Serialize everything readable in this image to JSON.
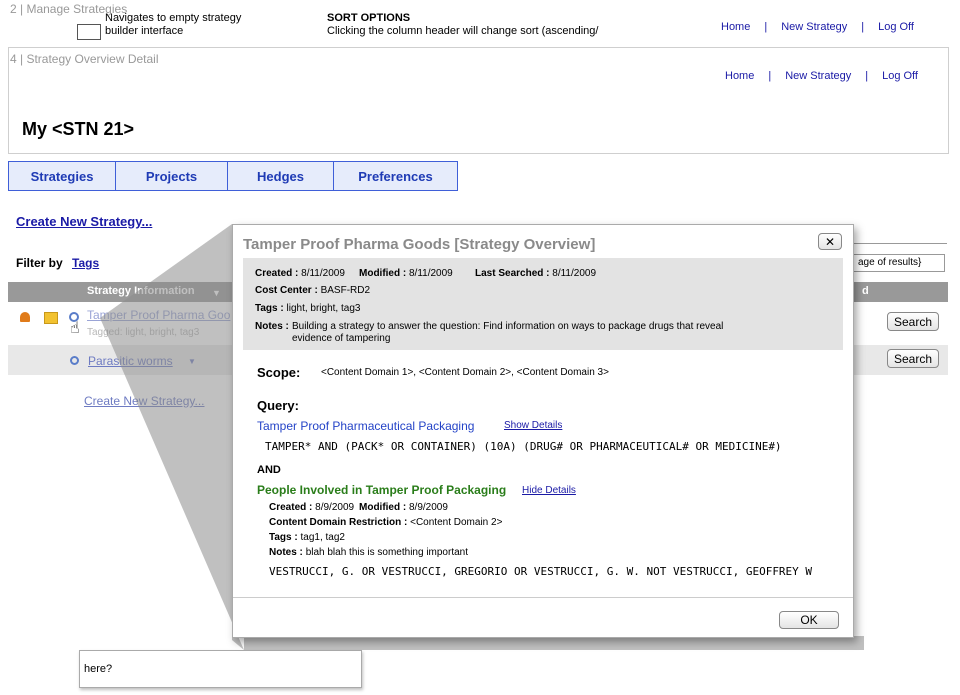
{
  "top_strip": {
    "title": "2 | Manage Strategies",
    "note": "Navigates to empty strategy builder interface",
    "sort_title": "SORT OPTIONS",
    "sort_text": "Clicking the column header will change sort (ascending/",
    "links": {
      "home": "Home",
      "new_strategy": "New Strategy",
      "log_off": "Log Off",
      "sep": "|"
    }
  },
  "panel": {
    "title": "4 | Strategy Overview Detail",
    "links": {
      "home": "Home",
      "new_strategy": "New Strategy",
      "log_off": "Log Off",
      "sep": "|"
    },
    "page_title": "My <STN 21>"
  },
  "tabs": [
    "Strategies",
    "Projects",
    "Hedges",
    "Preferences"
  ],
  "create_link": "Create New Strategy...",
  "filter": {
    "label": "Filter by",
    "link": "Tags"
  },
  "table": {
    "header_left": "Strategy Information",
    "header_right": "d",
    "page_box": "age of results}",
    "rows": [
      {
        "name": "Tamper Proof Pharma Goo",
        "tagged": "Tagged: light, bright, tag3",
        "button": "Search"
      },
      {
        "name": "Parasitic worms",
        "button": "Search"
      }
    ],
    "create_link": "Create New Strategy..."
  },
  "bottom_note": "here?",
  "modal": {
    "title": "Tamper Proof Pharma Goods [Strategy Overview]",
    "close": "✕",
    "meta": {
      "created_label": "Created :",
      "created": "8/11/2009",
      "modified_label": "Modified :",
      "modified": "8/11/2009",
      "searched_label": "Last Searched :",
      "searched": "8/11/2009",
      "cost_label": "Cost Center :",
      "cost": "BASF-RD2",
      "tags_label": "Tags :",
      "tags": "light, bright, tag3",
      "notes_label": "Notes :",
      "notes_line1": "Building a strategy to answer the question: Find information on ways to package drugs that reveal",
      "notes_line2": "evidence of tampering"
    },
    "scope_label": "Scope:",
    "scope_value": "<Content Domain 1>, <Content Domain 2>, <Content Domain 3>",
    "query_label": "Query:",
    "q1": {
      "title": "Tamper Proof Pharmaceutical Packaging",
      "link": "Show Details",
      "text": "TAMPER* AND (PACK* OR CONTAINER) (10A) (DRUG# OR PHARMACEUTICAL# OR MEDICINE#)"
    },
    "and": "AND",
    "q2": {
      "title": "People Involved in Tamper Proof Packaging",
      "link": "Hide Details",
      "created_label": "Created :",
      "created": "8/9/2009",
      "modified_label": "Modified :",
      "modified": "8/9/2009",
      "domain_label": "Content Domain Restriction :",
      "domain": "<Content Domain 2>",
      "tags_label": "Tags :",
      "tags": "tag1, tag2",
      "notes_label": "Notes :",
      "notes": "blah blah this is something important",
      "text": "VESTRUCCI, G. OR VESTRUCCI, GREGORIO OR VESTRUCCI, G. W.  NOT VESTRUCCI, GEOFFREY W"
    },
    "ok": "OK"
  },
  "colors": {
    "tab_border": "#3f5fd8",
    "tab_bg": "#e6ecfb",
    "link": "#1a1aa6",
    "green": "#2a7d1a",
    "blue_title": "#2443c7"
  }
}
